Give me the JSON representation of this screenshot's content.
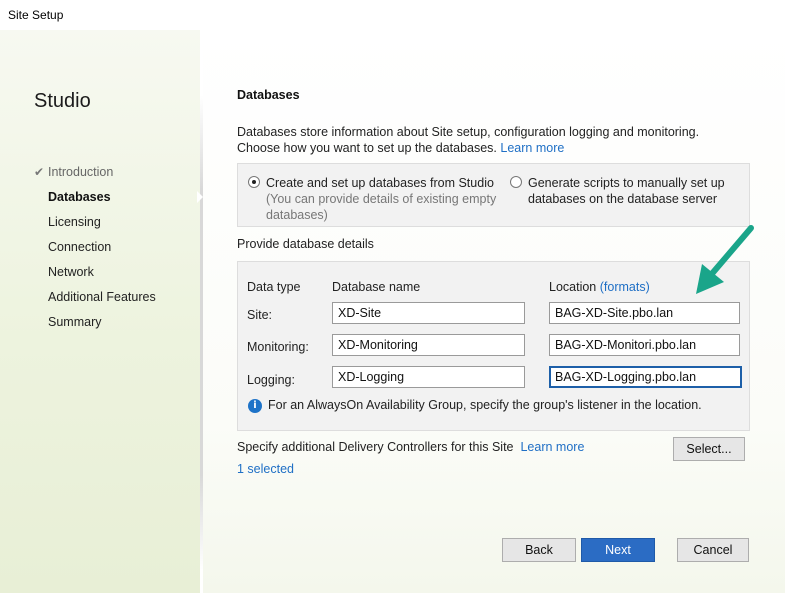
{
  "window": {
    "title": "Site Setup"
  },
  "sidebar": {
    "brand": "Studio",
    "steps": [
      {
        "label": "Introduction",
        "state": "done"
      },
      {
        "label": "Databases",
        "state": "active"
      },
      {
        "label": "Licensing",
        "state": "pending"
      },
      {
        "label": "Connection",
        "state": "pending"
      },
      {
        "label": "Network",
        "state": "pending"
      },
      {
        "label": "Additional Features",
        "state": "pending"
      },
      {
        "label": "Summary",
        "state": "pending"
      }
    ]
  },
  "main": {
    "heading": "Databases",
    "intro_line1": "Databases store information about Site setup, configuration logging and monitoring.",
    "intro_line2": "Choose how you want to set up the databases.",
    "learn_more": "Learn more",
    "radio_create": {
      "label": "Create and set up databases from Studio",
      "sub1": "(You can provide details of existing empty",
      "sub2": "databases)",
      "checked": true
    },
    "radio_scripts": {
      "label1": "Generate scripts to manually set up",
      "label2": "databases on the database server",
      "checked": false
    },
    "provide_label": "Provide database details",
    "table": {
      "col_type": "Data type",
      "col_name": "Database name",
      "col_location": "Location",
      "formats_link": "(formats)",
      "rows": [
        {
          "type": "Site:",
          "name": "XD-Site",
          "location": "BAG-XD-Site.pbo.lan"
        },
        {
          "type": "Monitoring:",
          "name": "XD-Monitoring",
          "location": "BAG-XD-Monitori.pbo.lan"
        },
        {
          "type": "Logging:",
          "name": "XD-Logging",
          "location": "BAG-XD-Logging.pbo.lan"
        }
      ]
    },
    "info_text": "For an AlwaysOn Availability Group, specify the group's listener in the location.",
    "controllers_label": "Specify additional Delivery Controllers for this Site",
    "controllers_learn_more": "Learn more",
    "select_button": "Select...",
    "selected_count": "1 selected"
  },
  "footer": {
    "back": "Back",
    "next": "Next",
    "cancel": "Cancel"
  },
  "colors": {
    "accent": "#1f6fc5",
    "arrow": "#1aa58a",
    "primary_button": "#2b6cc4"
  }
}
